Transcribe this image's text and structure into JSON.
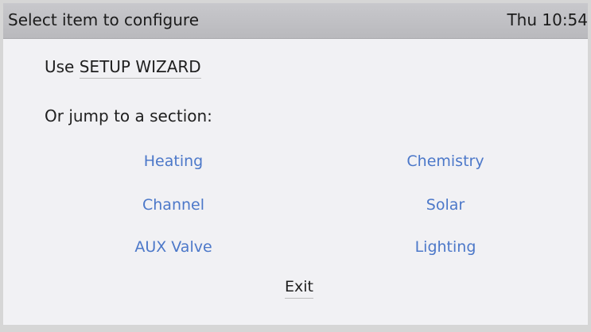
{
  "header": {
    "title": "Select item to configure",
    "clock": "Thu 10:54"
  },
  "wizard": {
    "prefix": "Use",
    "link_label": "SETUP WIZARD"
  },
  "jump_prompt": "Or jump to a section:",
  "sections": {
    "heating": "Heating",
    "chemistry": "Chemistry",
    "channel": "Channel",
    "solar": "Solar",
    "aux_valve": "AUX Valve",
    "lighting": "Lighting"
  },
  "exit_label": "Exit",
  "colors": {
    "link": "#4c78c9",
    "title_bar": "#bfbfc3",
    "screen_bg": "#f1f1f4"
  }
}
